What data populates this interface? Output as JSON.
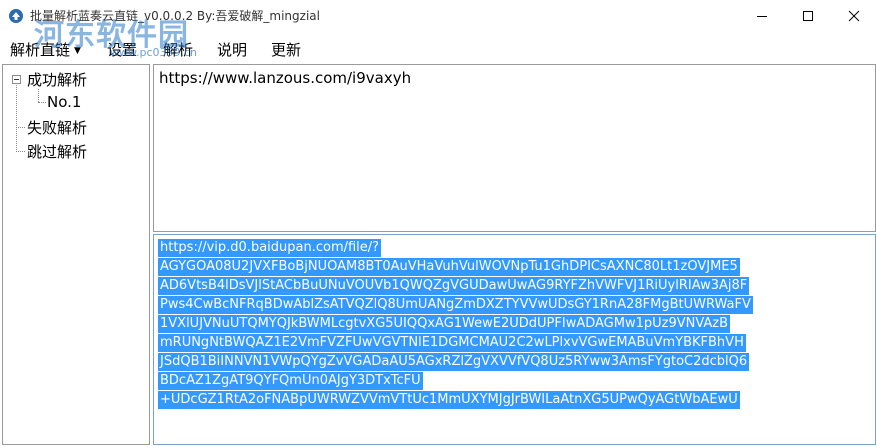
{
  "window": {
    "title": "批量解析蓝奏云直链_v0.0.0.2 By:吾爱破解_mingzial",
    "icon": "app-icon",
    "controls": [
      "minimize-icon",
      "maximize-icon",
      "close-icon"
    ]
  },
  "watermark": {
    "text": "河东软件园",
    "url": "www.pc0359.cn"
  },
  "menu": {
    "items": [
      {
        "label": "解析直链",
        "has_arrow": true
      },
      {
        "label": "设置"
      },
      {
        "label": "解析"
      },
      {
        "label": "说明"
      },
      {
        "label": "更新"
      }
    ]
  },
  "tree": {
    "success": "成功解析",
    "success_child": "No.1",
    "fail": "失败解析",
    "skip": "跳过解析"
  },
  "input": {
    "url": "https://www.lanzous.com/i9vaxyh"
  },
  "output": {
    "lines": [
      "https://vip.d0.baidupan.com/file/?",
      "AGYGOA08U2JVXFBoBjNUOAM8BT0AuVHaVuhVulWOVNpTu1GhDPICsAXNC80Lt1zOVJME5",
      "AD6VtsB4lDsVJlStACbBuUNuVOUVb1QWQZgVGUDawUwAG9RYFZhVWFVJ1RiUylRIAw3Aj8F",
      "Pws4CwBcNFRqBDwAblZsATVQZlQ8UmUANgZmDXZTYVVwUDsGY1RnA28FMgBtUWRWaFV",
      "1VXlUJVNuUTQMYQJkBWMLcgtvXG5UIQQxAG1WewE2UDdUPFIwADAGMw1pUz9VNVAzB",
      "mRUNgNtBWQAZ1E2VmFVZFUwVGVTNlE1DGMCMAU2C2wLPlxvVGwEMABuVmYBKFBhVH",
      "JSdQB1BiINNVN1VWpQYgZvVGADaAU5AGxRZlZgVXVVfVQ8Uz5RYww3AmsFYgtoC2dcblQ6",
      "BDcAZ1ZgAT9QYFQmUn0AJgY3DTxTcFU",
      "+UDcGZ1RtA2oFNABpUWRWZVVmVTtUc1MmUXYMJgJrBWILaAtnXG5UPwQyAGtWbAEwU"
    ]
  }
}
